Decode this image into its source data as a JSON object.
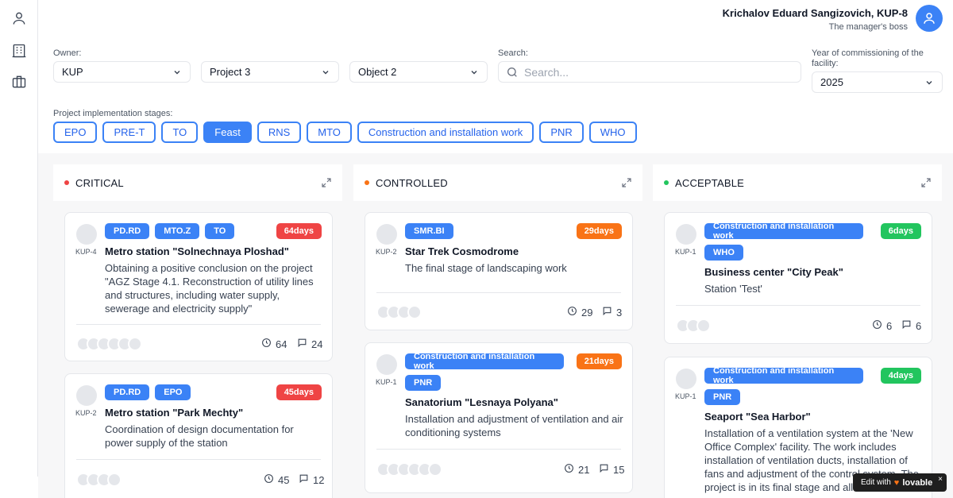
{
  "user": {
    "name": "Krichalov Eduard Sangizovich, KUP-8",
    "role": "The manager's boss"
  },
  "filters": {
    "owner_label": "Owner:",
    "owner_value": "KUP",
    "project_value": "Project 3",
    "object_value": "Object 2",
    "search_label": "Search:",
    "search_placeholder": "Search...",
    "year_label": "Year of commissioning of the facility:",
    "year_value": "2025"
  },
  "stages_label": "Project implementation stages:",
  "stages": [
    {
      "label": "EPO",
      "active": false
    },
    {
      "label": "PRE-T",
      "active": false
    },
    {
      "label": "TO",
      "active": false
    },
    {
      "label": "Feast",
      "active": true
    },
    {
      "label": "RNS",
      "active": false
    },
    {
      "label": "MTO",
      "active": false
    },
    {
      "label": "Construction and installation work",
      "active": false
    },
    {
      "label": "PNR",
      "active": false
    },
    {
      "label": "WHO",
      "active": false
    }
  ],
  "colors": {
    "critical": "#ef4444",
    "controlled": "#f97316",
    "acceptable": "#22c55e",
    "accent": "#3b82f6"
  },
  "columns": [
    {
      "title": "CRITICAL",
      "cards": [
        {
          "code": "KUP-4",
          "tags": [
            "PD.RD",
            "MTO.Z",
            "TO"
          ],
          "days": "64days",
          "title": "Metro station \"Solnechnaya Ploshad\"",
          "desc": "Obtaining a positive conclusion on the project \"AGZ Stage 4.1. Reconstruction of utility lines and structures, including water supply, sewerage and electricity supply\"",
          "time": "64",
          "comments": "24"
        },
        {
          "code": "KUP-2",
          "tags": [
            "PD.RD",
            "EPO"
          ],
          "days": "45days",
          "title": "Metro station \"Park Mechty\"",
          "desc": "Coordination of design documentation for power supply of the station",
          "time": "45",
          "comments": "12"
        }
      ]
    },
    {
      "title": "CONTROLLED",
      "cards": [
        {
          "code": "KUP-2",
          "tags": [
            "SMR.BI"
          ],
          "days": "29days",
          "title": "Star Trek Cosmodrome",
          "desc": "The final stage of landscaping work",
          "time": "29",
          "comments": "3"
        },
        {
          "code": "KUP-1",
          "tags": [
            "Construction and installation work",
            "PNR"
          ],
          "days": "21days",
          "title": "Sanatorium \"Lesnaya Polyana\"",
          "desc": "Installation and adjustment of ventilation and air conditioning systems",
          "time": "21",
          "comments": "15"
        }
      ]
    },
    {
      "title": "ACCEPTABLE",
      "cards": [
        {
          "code": "KUP-1",
          "tags": [
            "Construction and installation work",
            "WHO"
          ],
          "days": "6days",
          "title": "Business center \"City Peak\"",
          "desc": "Station 'Test'",
          "time": "6",
          "comments": "6"
        },
        {
          "code": "KUP-1",
          "tags": [
            "Construction and installation work",
            "PNR"
          ],
          "days": "4days",
          "title": "Seaport \"Sea Harbor\"",
          "desc": "Installation of a ventilation system at the 'New Office Complex' facility. The work includes installation of ventilation ducts, installation of fans and adjustment of the control system. The project is in its final stage and all work must",
          "time": "",
          "comments": ""
        }
      ]
    }
  ],
  "lovable": {
    "prefix": "Edit with",
    "brand": "lovable",
    "close": "×"
  }
}
